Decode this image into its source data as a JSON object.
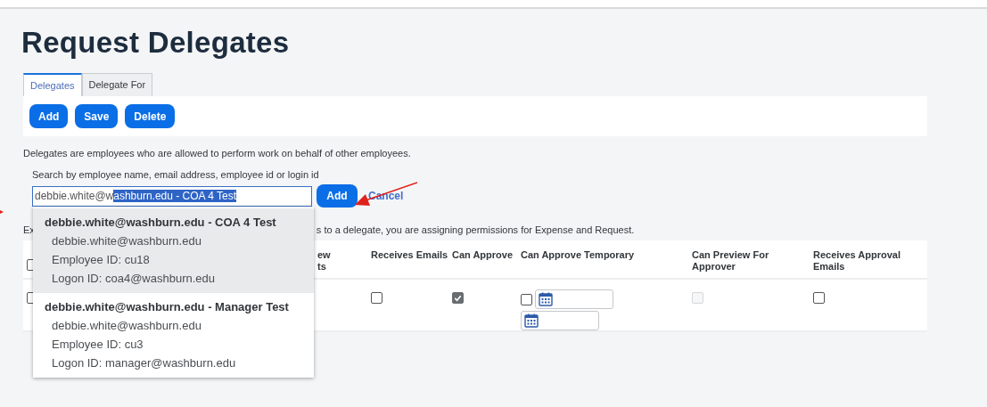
{
  "title": "Request Delegates",
  "tabs": [
    {
      "label": "Delegates",
      "selected": true
    },
    {
      "label": "Delegate For",
      "selected": false
    }
  ],
  "toolbar": [
    "Add",
    "Save",
    "Delete"
  ],
  "description": "Delegates are employees who are allowed to perform work on behalf of other employees.",
  "search": {
    "label": "Search by employee name, email address, employee id or login id",
    "value": "debbie.white@w",
    "selected_text": "ashburn.edu - COA 4 Test",
    "add": "Add",
    "cancel": "Cancel"
  },
  "suggestions": [
    {
      "title": "debbie.white@washburn.edu - COA 4 Test",
      "lines": [
        "debbie.white@washburn.edu",
        "Employee ID: cu18",
        "Logon ID: coa4@washburn.edu"
      ],
      "selected": true
    },
    {
      "title": "debbie.white@washburn.edu - Manager Test",
      "lines": [
        "debbie.white@washburn.edu",
        "Employee ID: cu3",
        "Logon ID: manager@washburn.edu"
      ],
      "selected": false
    }
  ],
  "explanation": {
    "start": "Ex",
    "end": "s to a delegate, you are assigning permissions for Expense and Request."
  },
  "table": {
    "select_all": {
      "checked": false
    },
    "columns": [
      "ew\nts",
      "Receives Emails",
      "Can Approve",
      "Can Approve Temporary",
      "Can Preview For Approver",
      "Receives Approval Emails"
    ],
    "rows": [
      {
        "select": {
          "checked": false
        },
        "receives_emails": {
          "checked": false
        },
        "can_approve": {
          "checked": true,
          "disabled": true
        },
        "can_approve_temporary": {
          "checked": false
        },
        "can_preview": {
          "checked": false,
          "disabled": true
        },
        "receives_approval_emails": {
          "checked": false
        }
      }
    ]
  }
}
